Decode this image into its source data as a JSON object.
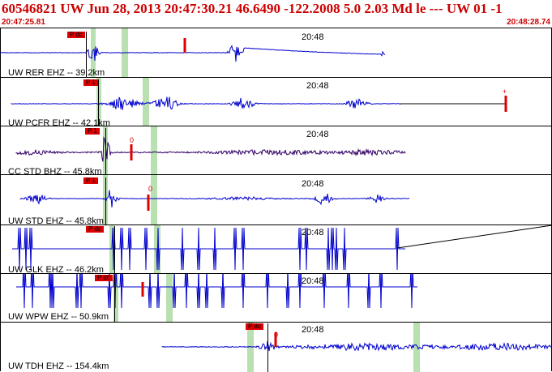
{
  "header": {
    "title": "60546821 UW Jun 28, 2013 20:47:30.21   46.6490 -122.2008  5.0 2.03 Md le --- UW 01  -1",
    "time_start": "20:47:25.81",
    "time_end": "20:48:28.74"
  },
  "panels": [
    {
      "label": "UW RER EHZ -- 39.2km",
      "time_mark": "20:48",
      "pick": "P dc",
      "color": "#0000cc"
    },
    {
      "label": "UW PCFR EHZ -- 42.1km",
      "time_mark": "20:48",
      "pick": "P 1",
      "color": "#0000cc"
    },
    {
      "label": "CC STD BHZ -- 45.8km",
      "time_mark": "20:48",
      "pick": "P 1",
      "color": "#330066"
    },
    {
      "label": "UW STD EHZ -- 45.8km",
      "time_mark": "20:48",
      "pick": "P 1",
      "color": "#0000cc"
    },
    {
      "label": "UW GLK EHZ -- 46.2km",
      "time_mark": "20:48",
      "pick": "P dc",
      "color": "#0000cc"
    },
    {
      "label": "UW WPW EHZ -- 50.9km",
      "time_mark": "20:48",
      "pick": "P dc",
      "color": "#0000cc"
    },
    {
      "label": "UW TDH EHZ -- 154.4km",
      "time_mark": "20:48",
      "pick": "P dc",
      "color": "#0000cc"
    }
  ],
  "marks": {
    "s_label": "0",
    "plus_label": "+"
  }
}
